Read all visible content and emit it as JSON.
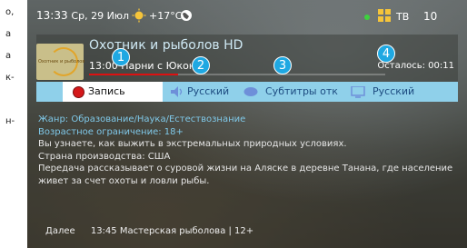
{
  "left_strip": [
    "о,",
    "а",
    "а",
    "к-",
    "",
    "",
    "",
    "н-"
  ],
  "status": {
    "clock": "13:33",
    "date": "Ср, 29 Июл",
    "temperature": "+17°C",
    "tv_label": "ТВ",
    "channel_number": "10"
  },
  "channel": {
    "logo_text": "Охотник и рыболов",
    "name": "Охотник и рыболов HD",
    "program": "13:00  Парни с Юкона",
    "remaining": "Осталось: 00:11",
    "progress": 0.3
  },
  "actions": {
    "record_label": "Запись",
    "audio_label": "Русский",
    "subtitles_label": "Субтитры отк",
    "language_label": "Русский"
  },
  "badges": [
    "1",
    "2",
    "3",
    "4"
  ],
  "description": {
    "genre": "Жанр: Образование/Наука/Естествознание",
    "age": "Возрастное ограничение: 18+",
    "line1": "Вы узнаете, как выжить в экстремальных природных условиях.",
    "country": "Страна производства: США",
    "line2": "Передача рассказывает о суровой жизни на Аляске в деревне Танана, где население живет за счет охоты и ловли рыбы."
  },
  "next": {
    "label": "Далее",
    "program": "13:45  Мастерская рыболова | 12+"
  },
  "colors": {
    "accent": "#1fa8e2",
    "actionbar": "#8fd0ea",
    "record": "#d4181a",
    "progress": "#dd1111"
  }
}
